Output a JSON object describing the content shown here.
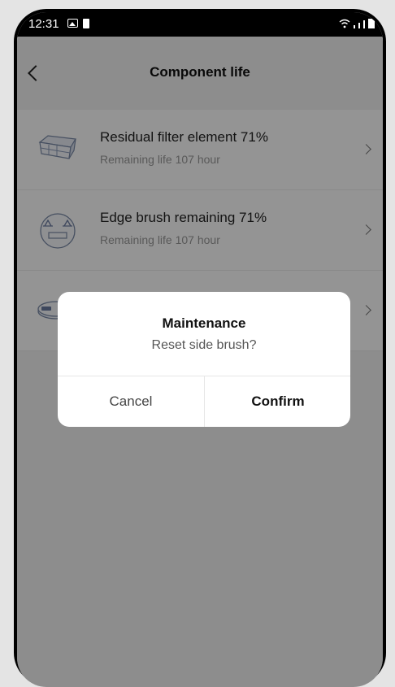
{
  "status_bar": {
    "time": "12:31"
  },
  "header": {
    "title": "Component life"
  },
  "components": [
    {
      "icon": "filter-icon",
      "name": "Residual filter element 71%",
      "remaining": "Remaining life 107 hour"
    },
    {
      "icon": "edge-brush-icon",
      "name": "Edge brush remaining 71%",
      "remaining": "Remaining life 107 hour"
    },
    {
      "icon": "main-brush-icon",
      "name": "",
      "remaining": ""
    }
  ],
  "dialog": {
    "title": "Maintenance",
    "message": "Reset side brush?",
    "cancel_label": "Cancel",
    "confirm_label": "Confirm"
  }
}
